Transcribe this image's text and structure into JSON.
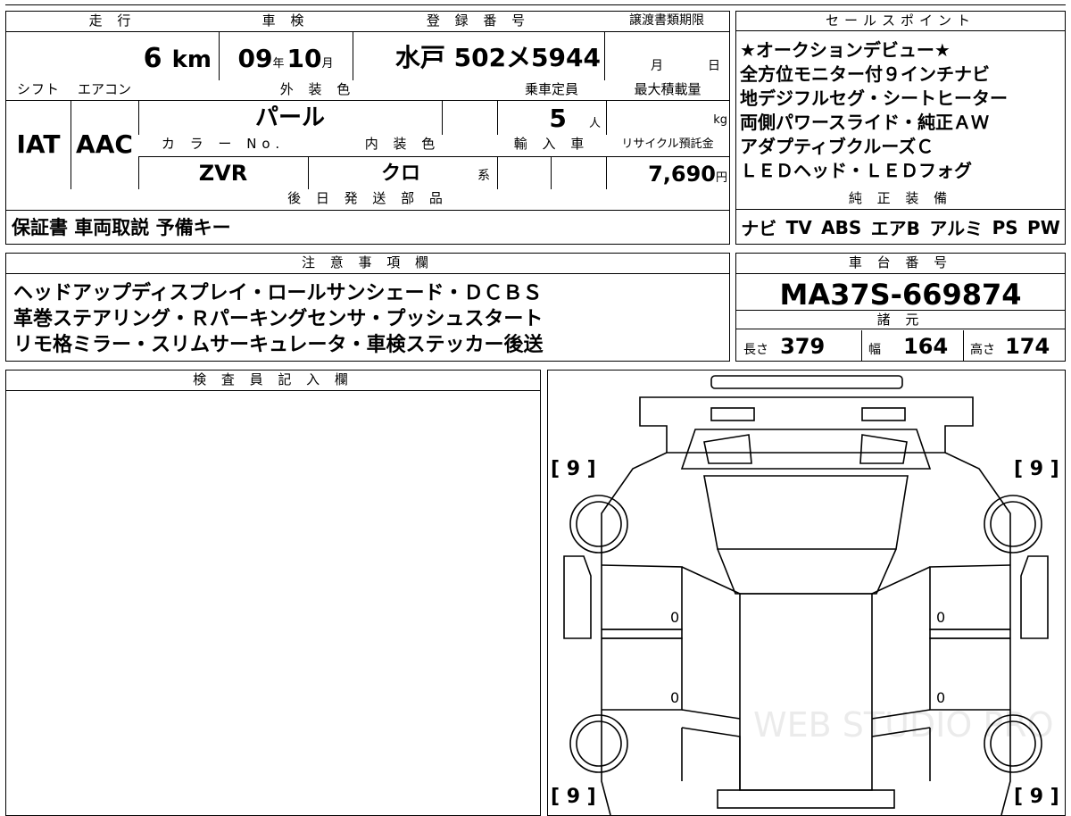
{
  "top_fields": {
    "mileage": {
      "label": "走 行",
      "value": "6",
      "unit": "km"
    },
    "shaken": {
      "label": "車 検",
      "year": "09",
      "year_unit": "年",
      "month": "10",
      "month_unit": "月"
    },
    "registration": {
      "label": "登 録 番 号",
      "value": "水戸 502メ5944"
    },
    "transfer_deadline": {
      "label": "譲渡書類期限",
      "month_unit": "月",
      "day_unit": "日"
    }
  },
  "second_fields": {
    "shift": {
      "label": "シフト",
      "value": "IAT"
    },
    "aircon": {
      "label": "エアコン",
      "value": "AAC"
    },
    "exterior_color": {
      "label": "外 装 色",
      "value": "パール"
    },
    "capacity": {
      "label": "乗車定員",
      "value": "5",
      "unit": "人"
    },
    "max_load": {
      "label": "最大積載量",
      "unit": "kg"
    },
    "color_no": {
      "label": "カ ラ ー No.",
      "value": "ZVR"
    },
    "interior_color": {
      "label": "内 装 色",
      "value": "クロ",
      "suffix": "系"
    },
    "import": {
      "label": "輸 入 車"
    },
    "recycle": {
      "label": "リサイクル預託金",
      "value": "7,690",
      "unit": "円"
    }
  },
  "later_parts": {
    "label": "後 日 発 送 部 品",
    "value": "保証書 車両取説 予備キー"
  },
  "sales_points": {
    "label": "セールスポイント",
    "lines": [
      "★オークションデビュー★",
      "全方位モニター付９インチナビ",
      "地デジフルセグ・シートヒーター",
      "両側パワースライド・純正ＡＷ",
      "アダプティブクルーズＣ",
      "ＬＥＤヘッド・ＬＥＤフォグ"
    ]
  },
  "genuine_equipment": {
    "label": "純 正 装 備",
    "items": [
      "ナビ",
      "TV",
      "ABS",
      "エアB",
      "アルミ",
      "PS",
      "PW"
    ]
  },
  "notes": {
    "label": "注 意 事 項 欄",
    "lines": [
      "ヘッドアップディスプレイ・ロールサンシェード・ＤＣＢＳ",
      "革巻ステアリング・Ｒパーキングセンサ・プッシュスタート",
      "リモ格ミラー・スリムサーキュレータ・車検ステッカー後送"
    ]
  },
  "chassis": {
    "label": "車 台 番 号",
    "value": "MA37S-669874"
  },
  "specs": {
    "label": "諸 元",
    "length_label": "長さ",
    "length": "379",
    "width_label": "幅",
    "width": "164",
    "height_label": "高さ",
    "height": "174"
  },
  "inspector": {
    "label": "検 査 員 記 入 欄"
  },
  "diagram": {
    "tire_fl": "[ 9 ]",
    "tire_fr": "[ 9 ]",
    "tire_rl": "[ 9 ]",
    "tire_rr": "[ 9 ]",
    "panel_marks": [
      "0",
      "0",
      "0",
      "0"
    ],
    "watermark": "WEB STUDIO PRO"
  }
}
